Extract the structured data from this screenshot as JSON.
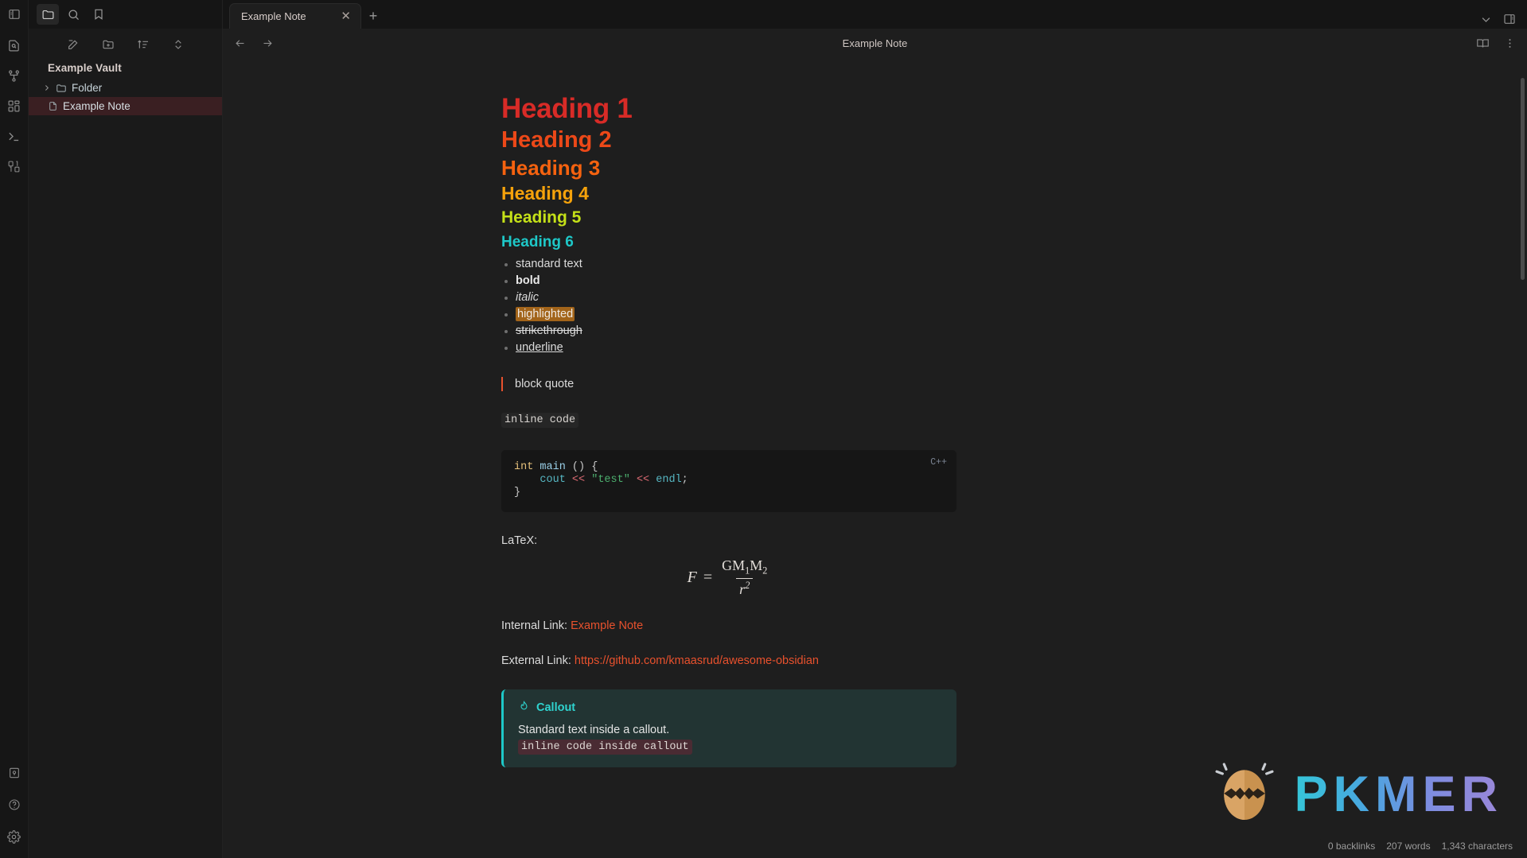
{
  "ribbon": {
    "top_icons": [
      {
        "name": "sidebar-toggle-icon",
        "label": "Toggle left sidebar"
      }
    ],
    "icons": [
      {
        "name": "file-search-icon",
        "label": "Search in file"
      },
      {
        "name": "graph-view-icon",
        "label": "Graph view"
      },
      {
        "name": "canvas-icon",
        "label": "Canvas"
      },
      {
        "name": "terminal-icon",
        "label": "Terminal"
      },
      {
        "name": "binary-icon",
        "label": "Binary"
      }
    ],
    "bottom_icons": [
      {
        "name": "vault-icon",
        "label": "Vault"
      },
      {
        "name": "help-icon",
        "label": "Help"
      },
      {
        "name": "settings-icon",
        "label": "Settings"
      }
    ]
  },
  "sidebar": {
    "tabs": [
      {
        "name": "files-tab",
        "label": "Files",
        "active": true
      },
      {
        "name": "search-tab",
        "label": "Search",
        "active": false
      },
      {
        "name": "bookmarks-tab",
        "label": "Bookmarks",
        "active": false
      }
    ],
    "nav_buttons": [
      {
        "name": "new-note-button",
        "label": "New note"
      },
      {
        "name": "new-folder-button",
        "label": "New folder"
      },
      {
        "name": "sort-button",
        "label": "Change sort order"
      },
      {
        "name": "collapse-button",
        "label": "Collapse all"
      }
    ],
    "vault_name": "Example Vault",
    "tree": [
      {
        "type": "folder",
        "label": "Folder",
        "selected": false
      },
      {
        "type": "file",
        "label": "Example Note",
        "selected": true
      }
    ]
  },
  "tabbar": {
    "tabs": [
      {
        "label": "Example Note",
        "close": "✕",
        "active": true
      }
    ],
    "new_tab": "+",
    "right_icons": [
      {
        "name": "chevron-down-icon",
        "label": "More tabs"
      },
      {
        "name": "right-sidebar-toggle-icon",
        "label": "Toggle right sidebar"
      }
    ]
  },
  "viewheader": {
    "back_label": "Navigate back",
    "forward_label": "Navigate forward",
    "title": "Example Note",
    "right_icons": [
      {
        "name": "reading-view-icon",
        "label": "Reading view"
      },
      {
        "name": "more-options-icon",
        "label": "More options"
      }
    ]
  },
  "note": {
    "headings": {
      "h1": "Heading 1",
      "h2": "Heading 2",
      "h3": "Heading 3",
      "h4": "Heading 4",
      "h5": "Heading 5",
      "h6": "Heading 6"
    },
    "list": [
      {
        "text": "standard text",
        "style": "normal"
      },
      {
        "text": "bold",
        "style": "bold"
      },
      {
        "text": "italic",
        "style": "italic"
      },
      {
        "text": "highlighted",
        "style": "highlight"
      },
      {
        "text": "strikethrough",
        "style": "strikethrough"
      },
      {
        "text": "underline",
        "style": "underline"
      }
    ],
    "blockquote": "block quote",
    "inline_code": "inline code",
    "codeblock": {
      "language_label": "C++",
      "tokens": [
        [
          {
            "t": "int",
            "c": "kw"
          },
          {
            "t": " ",
            "c": "plain"
          },
          {
            "t": "main",
            "c": "fn"
          },
          {
            "t": " () {",
            "c": "punc"
          }
        ],
        [
          {
            "t": "    ",
            "c": "plain"
          },
          {
            "t": "cout",
            "c": "var"
          },
          {
            "t": " ",
            "c": "plain"
          },
          {
            "t": "<<",
            "c": "op"
          },
          {
            "t": " ",
            "c": "plain"
          },
          {
            "t": "\"test\"",
            "c": "str"
          },
          {
            "t": " ",
            "c": "plain"
          },
          {
            "t": "<<",
            "c": "op"
          },
          {
            "t": " ",
            "c": "plain"
          },
          {
            "t": "endl",
            "c": "var"
          },
          {
            "t": ";",
            "c": "punc"
          }
        ],
        [
          {
            "t": "}",
            "c": "punc"
          }
        ]
      ]
    },
    "latex_label": "LaTeX:",
    "latex": {
      "lhs": "F",
      "eq": "=",
      "numerator_prefix": "GM",
      "numerator_sub1": "1",
      "numerator_mid": "M",
      "numerator_sub2": "2",
      "denominator_base": "r",
      "denominator_sup": "2"
    },
    "internal_link_label": "Internal Link:",
    "internal_link_text": "Example Note",
    "external_link_label": "External Link:",
    "external_link_text": "https://github.com/kmaasrud/awesome-obsidian",
    "callout": {
      "icon": "flame-icon",
      "title": "Callout",
      "body": "Standard text inside a callout.",
      "code": "inline code inside callout"
    }
  },
  "statusbar": {
    "backlinks": "0 backlinks",
    "words": "207 words",
    "characters": "1,343 characters"
  },
  "watermark": {
    "text": "PKMER"
  },
  "colors": {
    "h1": "#d82b27",
    "h2": "#ec4818",
    "h3": "#f5620f",
    "h4": "#f5a20b",
    "h5": "#c4e018",
    "h6": "#1ec8c8",
    "accent_link": "#e8512d",
    "highlight_bg": "#a2641a",
    "callout_border": "#1ec8c8",
    "callout_bg": "#223433",
    "selected_row_bg": "#3a1f22"
  }
}
